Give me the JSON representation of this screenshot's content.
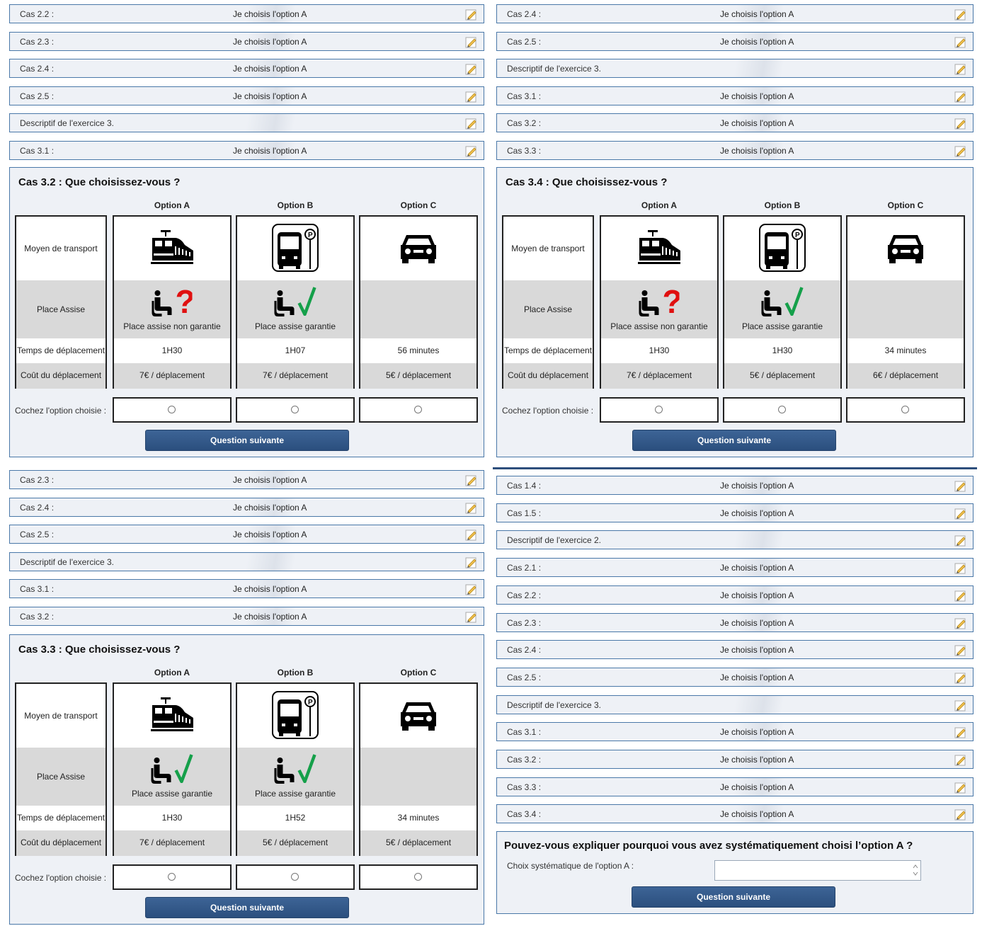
{
  "common": {
    "option_a": "Option A",
    "option_b": "Option B",
    "option_c": "Option C",
    "row_transport": "Moyen de transport",
    "row_seat": "Place Assise",
    "row_time": "Temps de déplacement",
    "row_cost": "Coût du déplacement",
    "choice_label": "Cochez l'option choisie :",
    "next_button": "Question suivante",
    "seat_not_guaranteed": "Place assise non garantie",
    "seat_guaranteed": "Place assise garantie",
    "answer": "Je choisis l'option A",
    "icons": {
      "edit": "pencil-edit-icon",
      "train": "train-icon",
      "bus": "bus-stop-icon",
      "car": "car-icon",
      "seat": "seat-icon",
      "check": "check-icon",
      "question": "question-mark-icon"
    }
  },
  "panel_tl": {
    "rows": [
      {
        "label": "Cas 2.2 :",
        "value": "Je choisis l'option A"
      },
      {
        "label": "Cas 2.3 :",
        "value": "Je choisis l'option A"
      },
      {
        "label": "Cas 2.4 :",
        "value": "Je choisis l'option A"
      },
      {
        "label": "Cas 2.5 :",
        "value": "Je choisis l'option A"
      },
      {
        "label": "Descriptif de l'exercice 3.",
        "value": ""
      },
      {
        "label": "Cas 3.1 :",
        "value": "Je choisis l'option A"
      }
    ],
    "title": "Cas 3.2 : Que choisissez-vous ?",
    "seat": [
      "Place assise non garantie",
      "Place assise garantie",
      ""
    ],
    "time": [
      "1H30",
      "1H07",
      "56 minutes"
    ],
    "cost": [
      "7€ / déplacement",
      "7€ / déplacement",
      "5€ / déplacement"
    ]
  },
  "panel_tr": {
    "rows": [
      {
        "label": "Cas 2.4 :",
        "value": "Je choisis l'option A"
      },
      {
        "label": "Cas 2.5 :",
        "value": "Je choisis l'option A"
      },
      {
        "label": "Descriptif de l'exercice 3.",
        "value": ""
      },
      {
        "label": "Cas 3.1 :",
        "value": "Je choisis l'option A"
      },
      {
        "label": "Cas 3.2 :",
        "value": "Je choisis l'option A"
      },
      {
        "label": "Cas 3.3 :",
        "value": "Je choisis l'option A"
      }
    ],
    "title": "Cas 3.4 : Que choisissez-vous ?",
    "seat": [
      "Place assise non garantie",
      "Place assise garantie",
      ""
    ],
    "time": [
      "1H30",
      "1H30",
      "34 minutes"
    ],
    "cost": [
      "7€ / déplacement",
      "5€ / déplacement",
      "6€ / déplacement"
    ]
  },
  "panel_bl": {
    "rows": [
      {
        "label": "Cas 2.3 :",
        "value": "Je choisis l'option A"
      },
      {
        "label": "Cas 2.4 :",
        "value": "Je choisis l'option A"
      },
      {
        "label": "Cas 2.5 :",
        "value": "Je choisis l'option A"
      },
      {
        "label": "Descriptif de l'exercice 3.",
        "value": ""
      },
      {
        "label": "Cas 3.1 :",
        "value": "Je choisis l'option A"
      },
      {
        "label": "Cas 3.2 :",
        "value": "Je choisis l'option A"
      }
    ],
    "title": "Cas 3.3 : Que choisissez-vous ?",
    "seat": [
      "Place assise garantie",
      "Place assise garantie",
      ""
    ],
    "time": [
      "1H30",
      "1H52",
      "34 minutes"
    ],
    "cost": [
      "7€ / déplacement",
      "5€ / déplacement",
      "5€ / déplacement"
    ]
  },
  "panel_br": {
    "rows": [
      {
        "label": "Cas 1.4 :",
        "value": "Je choisis l'option A"
      },
      {
        "label": "Cas 1.5 :",
        "value": "Je choisis l'option A"
      },
      {
        "label": "Descriptif de l'exercice 2.",
        "value": ""
      },
      {
        "label": "Cas 2.1 :",
        "value": "Je choisis l'option A"
      },
      {
        "label": "Cas 2.2 :",
        "value": "Je choisis l'option A"
      },
      {
        "label": "Cas 2.3 :",
        "value": "Je choisis l'option A"
      },
      {
        "label": "Cas 2.4 :",
        "value": "Je choisis l'option A"
      },
      {
        "label": "Cas 2.5 :",
        "value": "Je choisis l'option A"
      },
      {
        "label": "Descriptif de l'exercice 3.",
        "value": ""
      },
      {
        "label": "Cas 3.1 :",
        "value": "Je choisis l'option A"
      },
      {
        "label": "Cas 3.2 :",
        "value": "Je choisis l'option A"
      },
      {
        "label": "Cas 3.3 :",
        "value": "Je choisis l'option A"
      },
      {
        "label": "Cas 3.4 :",
        "value": "Je choisis l'option A"
      }
    ],
    "title": "Pouvez-vous expliquer pourquoi vous avez systématiquement choisi l’option A ?",
    "field_label": "Choix systématique de l'option A :",
    "field_value": ""
  }
}
